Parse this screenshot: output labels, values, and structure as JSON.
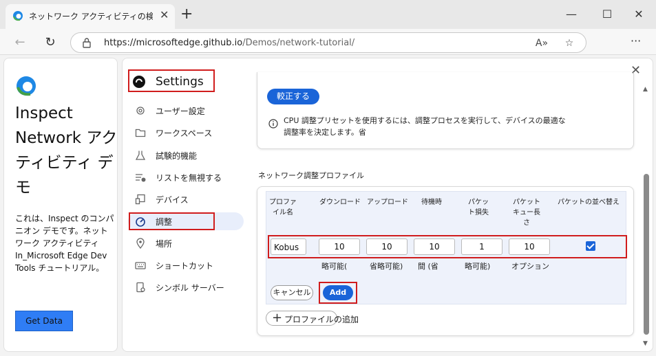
{
  "browser": {
    "tab_title": "ネットワーク アクティビティの検査のデモ",
    "tab_close": "✕",
    "new_tab": "+",
    "minimize": "—",
    "maximize": "☐",
    "close": "✕",
    "back": "←",
    "refresh": "↻",
    "url_host": "https://microsoftedge.github.io",
    "url_path": "/Demos/network-tutorial/",
    "read_aloud": "A»",
    "favorite": "☆",
    "more": "···"
  },
  "page": {
    "heading": "Inspect Network アクティビティ デモ",
    "description": "これは、Inspect のコンパニオン デモです。ネットワーク アクティビティ In_Microsoft Edge Dev Tools チュートリアル。",
    "get_data": "Get Data"
  },
  "settings": {
    "title": "Settings",
    "close": "✕",
    "nav": [
      {
        "label": "ユーザー設定",
        "icon": "gear-icon"
      },
      {
        "label": "ワークスペース",
        "icon": "folder-icon"
      },
      {
        "label": "試験的機能",
        "icon": "flask-icon"
      },
      {
        "label": "リストを無視する",
        "icon": "ignore-list-icon"
      },
      {
        "label": "デバイス",
        "icon": "devices-icon"
      },
      {
        "label": "調整",
        "icon": "gauge-icon"
      },
      {
        "label": "場所",
        "icon": "location-pin-icon"
      },
      {
        "label": "ショートカット",
        "icon": "keyboard-icon"
      },
      {
        "label": "シンボル サーバー",
        "icon": "symbol-server-icon"
      }
    ],
    "calibrate_label": "較正する",
    "calibrate_info": "CPU 調整プリセットを使用するには、調整プロセスを実行して、デバイスの最適な調整率を決定します。省",
    "section_title": "ネットワーク調整プロファイル",
    "columns": [
      "プロファイル名",
      "ダウンロード",
      "アップロード",
      "待機時",
      "パケット損失",
      "パケットキュー長さ",
      "パケットの並べ替え"
    ],
    "row": {
      "name": "Kobus",
      "download": "10",
      "upload": "10",
      "latency": "10",
      "packet_loss": "1",
      "queue_length": "10",
      "reorder": true
    },
    "sub_labels": [
      "略可能(",
      "省略可能)",
      "間 (省",
      "略可能)",
      "オプション"
    ],
    "cancel_label": "キャンセル",
    "add_label": "Add",
    "add_profile_label": "プロファイルの追加",
    "add_profile_plus": "+",
    "scroll_up": "▲",
    "scroll_down": "▼"
  },
  "colors": {
    "accent": "#1a64d8",
    "highlight": "#d01c1c",
    "get_data_bg": "#2f7df5"
  }
}
